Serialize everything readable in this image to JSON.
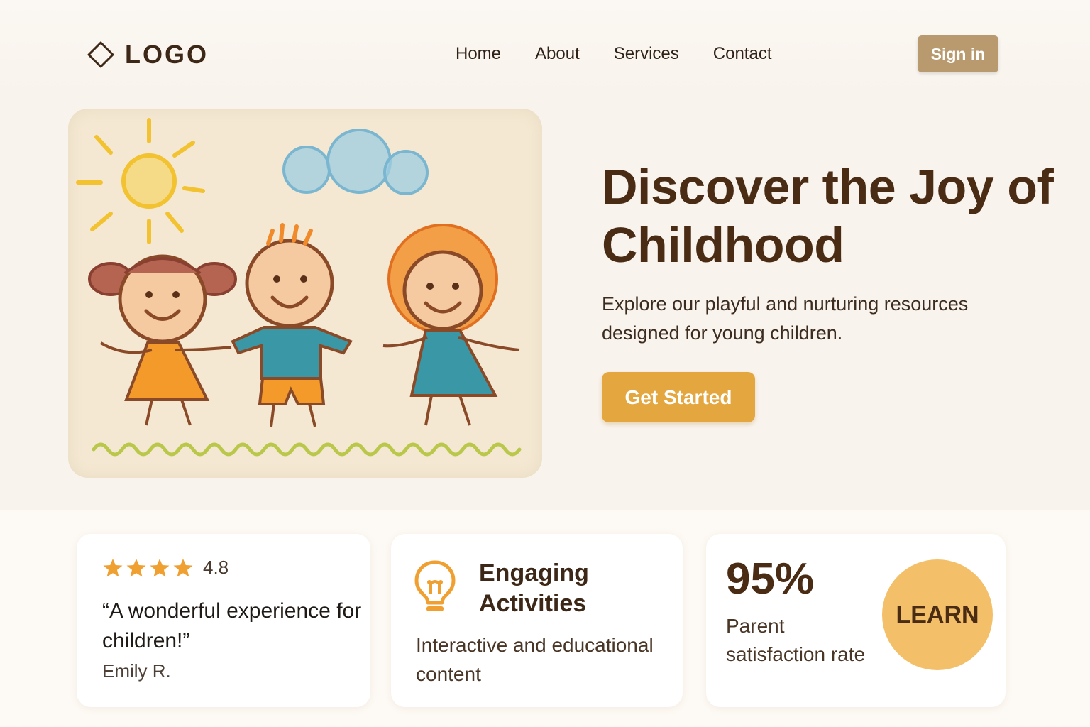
{
  "header": {
    "logo_text": "LOGO",
    "nav": [
      "Home",
      "About",
      "Services",
      "Contact"
    ],
    "signin_label": "Sign in"
  },
  "hero": {
    "title": "Discover the Joy of Childhood",
    "subtitle": "Explore our playful and nurturing resources designed for young children.",
    "cta_label": "Get Started",
    "illustration": "crayon-drawing-three-children-holding-hands"
  },
  "cards": {
    "review": {
      "stars": 4,
      "rating": "4.8",
      "quote": "“A wonderful experience for children!”",
      "author": "Emily R."
    },
    "activities": {
      "icon": "lightbulb-icon",
      "title": "Engaging Activities",
      "description": "Interactive and educational content"
    },
    "stats": {
      "percent": "95%",
      "description": "Parent satisfaction rate",
      "button_label": "LEARN"
    }
  },
  "colors": {
    "background": "#f8f3ec",
    "primary_text": "#4a2b14",
    "accent": "#e4a73f",
    "signin": "#b89a6e",
    "learn_circle": "#f3bf69"
  }
}
